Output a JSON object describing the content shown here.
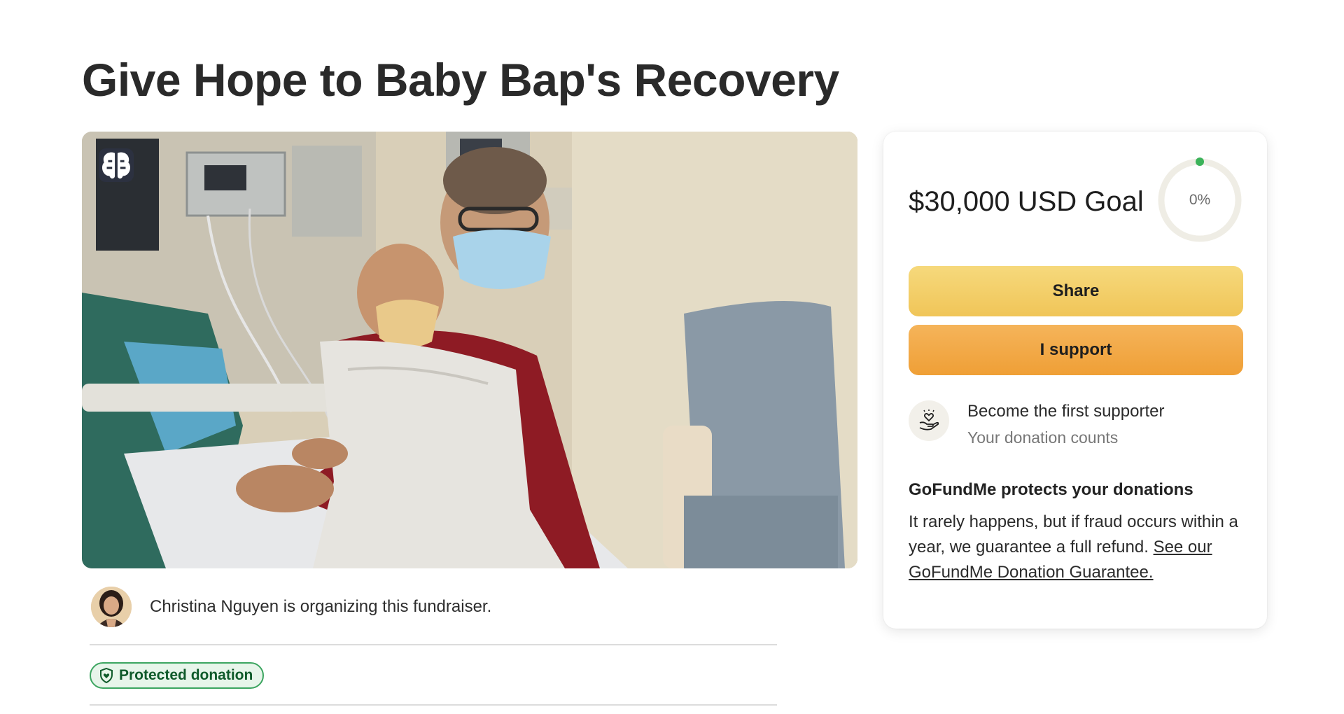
{
  "campaign": {
    "title": "Give Hope to Baby Bap's Recovery",
    "organizer_text": "Christina Nguyen is organizing this fundraiser.",
    "protected_label": "Protected donation"
  },
  "card": {
    "goal_text": "$30,000 USD Goal",
    "progress_percent": 0,
    "progress_label": "0%",
    "share_label": "Share",
    "support_label": "I support",
    "supporter_title": "Become the first supporter",
    "supporter_subtitle": "Your donation counts",
    "protect_heading": "GoFundMe protects your donations",
    "protect_body": "It rarely happens, but if fraud occurs within a year, we guarantee a full refund. ",
    "guarantee_link": "See our GoFundMe Donation Guarantee."
  },
  "icons": {
    "ai_badge": "brain-icon",
    "supporter": "heart-hands-icon",
    "protected": "shield-heart-icon"
  },
  "colors": {
    "share_button": "#f3cf6a",
    "support_button": "#f2aa45",
    "protected_green": "#3ca560",
    "progress_dot": "#3cb35a"
  }
}
